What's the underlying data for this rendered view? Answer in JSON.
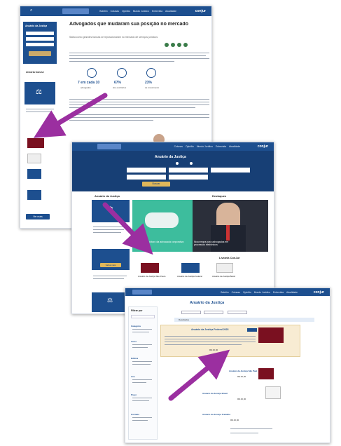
{
  "colors": {
    "brand_blue": "#1d4f8f",
    "dark_blue": "#173f75",
    "arrow": "#9b2fa0",
    "highlight": "#f8ecd3",
    "maroon": "#7a1020",
    "teal": "#3dbd9d"
  },
  "shot1": {
    "logo": "conjur",
    "nav": [
      "Atualidade",
      "Entrevista",
      "Mundo Jurídico",
      "Opinião",
      "Colunas",
      "Boletim"
    ],
    "title": "Advogados que mudaram sua posição no mercado",
    "subtitle": "Saiba como grandes bancas se reposicionaram no mercado de serviços jurídicos",
    "stats": [
      {
        "value": "7 em cada 10",
        "label": "advogados"
      },
      {
        "value": "67%",
        "label": "dos escritórios"
      },
      {
        "value": "23%",
        "label": "de crescimento"
      }
    ],
    "sidebar_title": "Anuário da Justiça",
    "sidebar_button": "Assine",
    "sidebar_section": "Livraria ConJur",
    "sidebar_more": "Ver mais"
  },
  "shot2": {
    "logo": "conjur",
    "nav": [
      "Atualidade",
      "Entrevista",
      "Mundo Jurídico",
      "Opinião",
      "Colunas"
    ],
    "hero_title": "Anuário da Justiça",
    "hero_button": "Buscar",
    "section_news": "Destaques",
    "section_books": "Livraria ConJur",
    "section_side": "Anuário da Justiça",
    "side_button": "Saiba mais",
    "news": [
      {
        "caption": "Nova regra para advogados em processos eletrônicos"
      },
      {
        "caption": "Entrevista: o futuro da advocacia corporativa"
      }
    ],
    "books": [
      {
        "title": "Anuário da Justiça Federal"
      },
      {
        "title": "Anuário da Justiça São Paulo"
      },
      {
        "title": "Anuário da Justiça Brasil"
      }
    ]
  },
  "shot3": {
    "logo": "conjur",
    "nav": [
      "Atualidade",
      "Entrevista",
      "Mundo Jurídico",
      "Opinião",
      "Colunas",
      "Boletim"
    ],
    "page_title": "Anuário da Justiça",
    "filter_title": "Filtrar por",
    "result_count": "Resultados",
    "results": [
      {
        "title": "Anuário da Justiça Federal 2023",
        "price": "R$ 40,00"
      },
      {
        "title": "Anuário da Justiça São Paulo",
        "price": "R$ 40,00"
      },
      {
        "title": "Anuário da Justiça Brasil",
        "price": "R$ 40,00"
      },
      {
        "title": "Anuário da Justiça Trabalho",
        "price": "R$ 40,00"
      }
    ],
    "filters": [
      "Categoria",
      "Autor",
      "Editora",
      "Ano",
      "Preço",
      "Formato"
    ]
  }
}
